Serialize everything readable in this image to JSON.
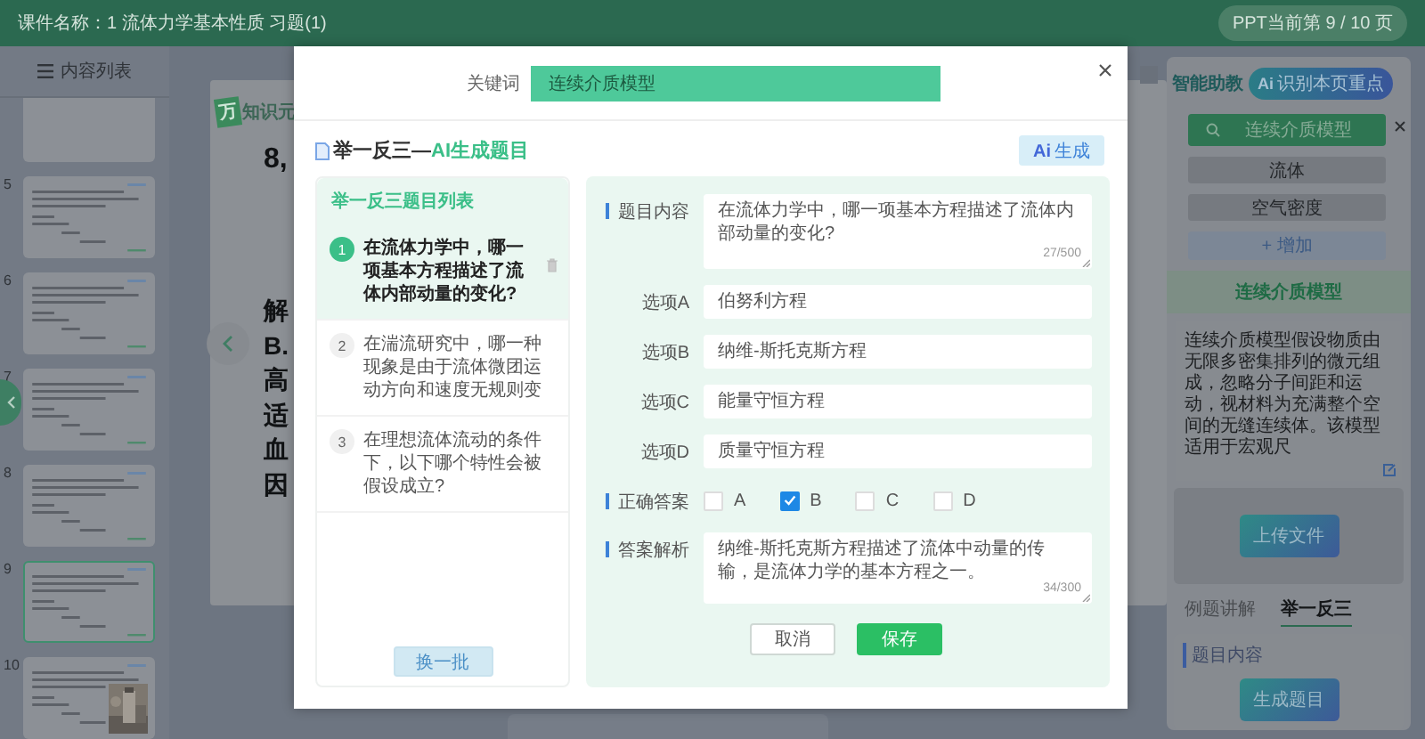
{
  "header": {
    "title": "课件名称：1 流体力学基本性质 习题(1)",
    "page_indicator": "PPT当前第 9 / 10 页"
  },
  "sidebar": {
    "title": "内容列表",
    "slides": [
      {
        "kind": "partial",
        "selected": false
      },
      {
        "number": "5",
        "kind": "text",
        "selected": false
      },
      {
        "number": "6",
        "kind": "text",
        "selected": false
      },
      {
        "number": "7",
        "kind": "text",
        "selected": false
      },
      {
        "number": "8",
        "kind": "text",
        "selected": false
      },
      {
        "number": "9",
        "kind": "text",
        "selected": true
      },
      {
        "number": "10",
        "selected": false
      }
    ]
  },
  "slide": {
    "logo_badge": "万",
    "logo_text": "知识元",
    "heading": "8,",
    "lines": [
      "解",
      "B.",
      "高",
      "适",
      "血",
      "因"
    ]
  },
  "assistant": {
    "title": "智能助教",
    "detect_mark": "Ai",
    "detect_button": "识别本页重点",
    "search": {
      "value": "连续介质模型"
    },
    "keywords": [
      "流体",
      "空气密度"
    ],
    "add_button": "+ 增加",
    "topic": "连续介质模型",
    "description": "连续介质模型假设物质由无限多密集排列的微元组成，忽略分子间距和运动，视材料为充满整个空间的无缝连续体。该模型适用于宏观尺",
    "upload_button": "上传文件",
    "tabs": [
      {
        "label": "例题讲解",
        "selected": false
      },
      {
        "label": "举一反三",
        "selected": true
      }
    ],
    "card_label": "题目内容",
    "generate_button": "生成题目"
  },
  "dialog": {
    "keyword_label": "关键词",
    "keyword": "连续介质模型",
    "heading": "举一反三—",
    "heading_highlight": "AI生成题目",
    "generate_mark": "Ai",
    "generate_button": "生成",
    "list_title": "举一反三题目列表",
    "questions": [
      {
        "number": "1",
        "text": "在流体力学中，哪一项基本方程描述了流体内部动量的变化?",
        "selected": true
      },
      {
        "number": "2",
        "text": "在湍流研究中，哪一种现象是由于流体微团运动方向和速度无规则变",
        "selected": false
      },
      {
        "number": "3",
        "text": "在理想流体流动的条件下，以下哪个特性会被假设成立?",
        "selected": false
      }
    ],
    "refresh_button": "换一批",
    "form": {
      "question_label": "题目内容",
      "question": "在流体力学中，哪一项基本方程描述了流体内部动量的变化?",
      "question_count": "27/500",
      "options": [
        {
          "label": "选项A",
          "value": "伯努利方程"
        },
        {
          "label": "选项B",
          "value": "纳维-斯托克斯方程"
        },
        {
          "label": "选项C",
          "value": "能量守恒方程"
        },
        {
          "label": "选项D",
          "value": "质量守恒方程"
        }
      ],
      "answer_label": "正确答案",
      "answers": [
        {
          "letter": "A",
          "checked": false
        },
        {
          "letter": "B",
          "checked": true
        },
        {
          "letter": "C",
          "checked": false
        },
        {
          "letter": "D",
          "checked": false
        }
      ],
      "analysis_label": "答案解析",
      "analysis": "纳维-斯托克斯方程描述了流体中动量的传输，是流体力学的基本方程之一。",
      "analysis_count": "34/300"
    },
    "cancel_button": "取消",
    "save_button": "保存"
  }
}
